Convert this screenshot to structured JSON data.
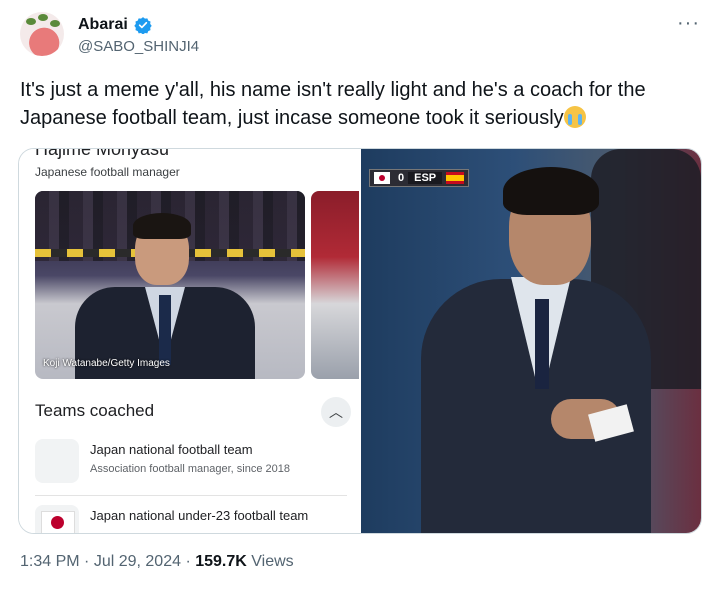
{
  "user": {
    "name": "Abarai",
    "handle": "@SABO_SHINJI4",
    "verified": true
  },
  "more_icon": "more-horizontal-icon",
  "tweet": {
    "text": "It's just a meme y'all, his name isn't really light and he's a coach for the Japanese football team, just incase someone took it seriously",
    "emoji": "loudly-crying-face"
  },
  "media_left": {
    "cut_title": "Hajime Moriyasu",
    "subtitle": "Japanese football manager",
    "photo_credit": "Koji Watanabe/Getty Images",
    "section_title": "Teams coached",
    "collapse_icon": "chevron-up-icon",
    "teams": [
      {
        "name": "Japan national football team",
        "desc": "Association football manager, since 2018"
      },
      {
        "name": "Japan national under-23 football team",
        "desc": ""
      }
    ]
  },
  "media_right": {
    "score_home_flag": "japan-flag",
    "score": "0",
    "away_team": "ESP",
    "score_away_flag": "spain-flag"
  },
  "footer": {
    "time": "1:34 PM",
    "date": "Jul 29, 2024",
    "views_count": "159.7K",
    "views_label": "Views"
  },
  "colors": {
    "text_primary": "#0f1419",
    "text_secondary": "#536471",
    "verified_blue": "#1d9bf0",
    "border": "#cfd9de"
  }
}
